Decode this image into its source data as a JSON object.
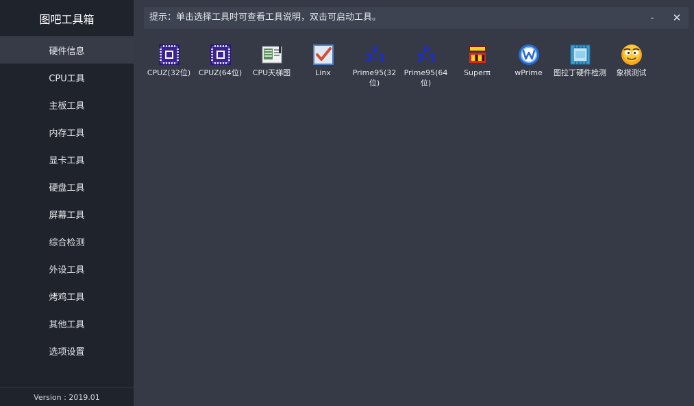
{
  "app": {
    "title": "图吧工具箱",
    "version": "Version : 2019.01"
  },
  "sidebar": {
    "items": [
      {
        "label": "硬件信息",
        "active": true
      },
      {
        "label": "CPU工具"
      },
      {
        "label": "主板工具"
      },
      {
        "label": "内存工具"
      },
      {
        "label": "显卡工具"
      },
      {
        "label": "硬盘工具"
      },
      {
        "label": "屏幕工具"
      },
      {
        "label": "综合检测"
      },
      {
        "label": "外设工具"
      },
      {
        "label": "烤鸡工具"
      },
      {
        "label": "其他工具"
      },
      {
        "label": "选项设置"
      }
    ]
  },
  "hint": {
    "text": "提示：单击选择工具时可查看工具说明，双击可启动工具。"
  },
  "window": {
    "minimize": "-",
    "close": "✕"
  },
  "tools": [
    {
      "label": "CPUZ(32位)",
      "icon": "cpu-chip-icon"
    },
    {
      "label": "CPUZ(64位)",
      "icon": "cpu-chip-icon"
    },
    {
      "label": "CPU天梯图",
      "icon": "chart-document-icon"
    },
    {
      "label": "Linx",
      "icon": "checkmark-box-icon"
    },
    {
      "label": "Prime95(32位)",
      "icon": "mersenne-prime-icon",
      "formula": {
        "base": "2",
        "exp": "P",
        "minus": "-1"
      }
    },
    {
      "label": "Prime95(64位)",
      "icon": "mersenne-prime-icon",
      "formula": {
        "base": "2",
        "exp": "P",
        "minus": "-1"
      }
    },
    {
      "label": "Superπ",
      "icon": "super-pi-logo-icon"
    },
    {
      "label": "wPrime",
      "icon": "w-circle-icon"
    },
    {
      "label": "图拉丁硬件检测",
      "icon": "p3s-chip-icon"
    },
    {
      "label": "象棋测试",
      "icon": "smiley-face-icon"
    }
  ],
  "colors": {
    "sidebar_bg": "#1f232c",
    "active_item_bg": "#363b47",
    "main_bg": "#353a46",
    "hint_bg": "#3d4350",
    "text": "#e8eaee"
  }
}
